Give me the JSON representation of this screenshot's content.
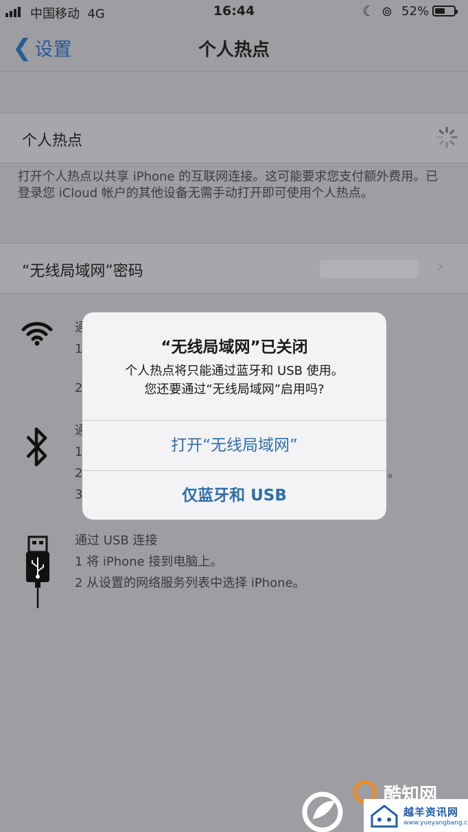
{
  "status_bar": {
    "carrier": "中国移动",
    "network": "4G",
    "time": "16:44",
    "battery": "52%",
    "battery_level": 0.52
  },
  "nav": {
    "back_label": "设置",
    "title": "个人热点"
  },
  "hotspot": {
    "label": "个人热点",
    "description": "打开个人热点以共享 iPhone 的互联网连接。这可能要求您支付额外费用。已登录您 iCloud 帐户的其他设备无需手动打开即可使用个人热点。"
  },
  "wifi_password": {
    "label": "“无线局域网”密码"
  },
  "instructions": {
    "wifi": {
      "heading": "通",
      "line1": "1",
      "line2": "2"
    },
    "bluetooth": {
      "heading": "通",
      "line1": "1",
      "line2": "2",
      "line2_tail": "。",
      "line3": "3"
    },
    "usb": {
      "heading": "通过 USB 连接",
      "line1": "1 将 iPhone 接到电脑上。",
      "line2": "2 从设置的网络服务列表中选择 iPhone。"
    }
  },
  "alert": {
    "title": "“无线局域网”已关闭",
    "message_line1": "个人热点将只能通过蓝牙和 USB 使用。",
    "message_line2": "您还要通过“无线局域网”启用吗?",
    "button_wifi": "打开“无线局域网”",
    "button_bt_usb": "仅蓝牙和 USB"
  },
  "watermarks": {
    "site1": "酷知网",
    "site2": "越羊资讯网",
    "site2_url": "www.yueyangbang.com"
  },
  "colors": {
    "link_blue": "#2f6ea8",
    "back_blue": "#255c95",
    "dim_background": "#9d9da2",
    "alert_background": "#f3f3f5"
  }
}
